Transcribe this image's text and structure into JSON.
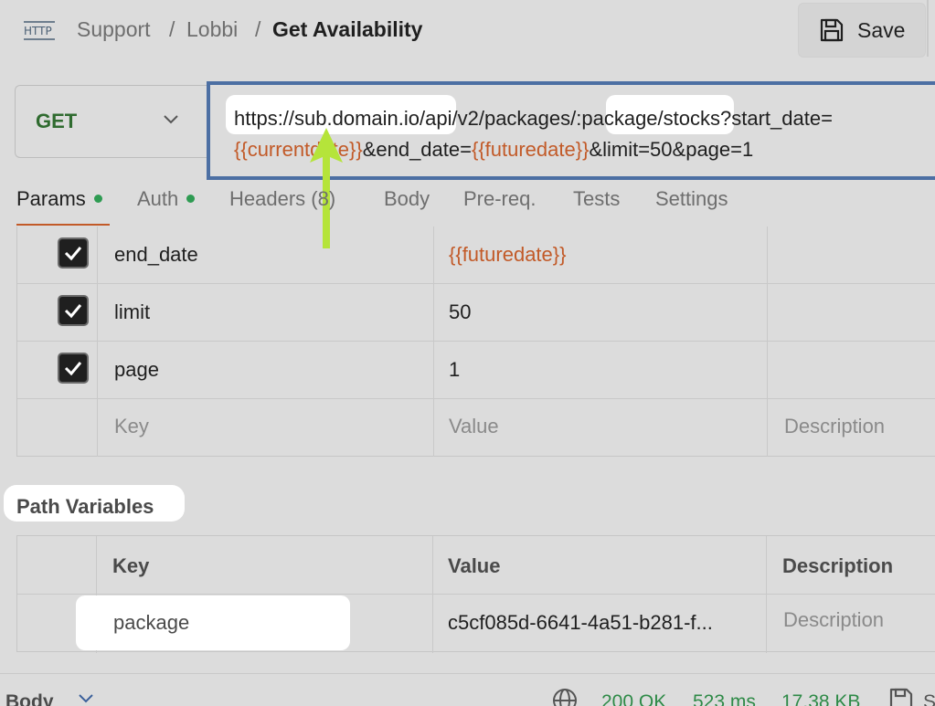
{
  "header": {
    "http_icon_label": "HTTP",
    "breadcrumbs": [
      "Support",
      "Lobbi"
    ],
    "separator": "/",
    "title": "Get Availability",
    "save_label": "Save"
  },
  "request": {
    "method": "GET",
    "url_line1": {
      "segments": [
        "https://",
        "sub.domain.io",
        "/api/v2/packages",
        "/:package/",
        "stocks?start_date="
      ]
    },
    "url_line2": {
      "var1": "{{currentdate}}",
      "mid": "&end_date=",
      "var2": "{{futuredate}}",
      "tail": "&limit=50&page=1"
    }
  },
  "tabs": [
    {
      "label": "Params",
      "dot": true,
      "active": true
    },
    {
      "label": "Auth",
      "dot": true
    },
    {
      "label": "Headers (8)"
    },
    {
      "label": "Body"
    },
    {
      "label": "Pre-req."
    },
    {
      "label": "Tests"
    },
    {
      "label": "Settings"
    }
  ],
  "params": {
    "rows": [
      {
        "key": "end_date",
        "value": "{{futuredate}}",
        "checked": true
      },
      {
        "key": "limit",
        "value": "50",
        "checked": true
      },
      {
        "key": "page",
        "value": "1",
        "checked": true
      }
    ],
    "placeholder": {
      "key": "Key",
      "value": "Value",
      "description": "Description"
    }
  },
  "path_variables": {
    "title": "Path Variables",
    "columns": [
      "Key",
      "Value",
      "Description"
    ],
    "rows": [
      {
        "key": "package",
        "value": "c5cf085d-6641-4a51-b281-f...",
        "description": "Description"
      }
    ]
  },
  "response_bar": {
    "body_label": "Body",
    "status": "200 OK",
    "time": "523 ms",
    "size": "17.38 KB",
    "save_partial": "S"
  },
  "colors": {
    "accent_var": "#c25a28",
    "status_green": "#2e8a47",
    "url_border": "#4c6fa3",
    "annotation_arrow": "#b5e43a"
  }
}
